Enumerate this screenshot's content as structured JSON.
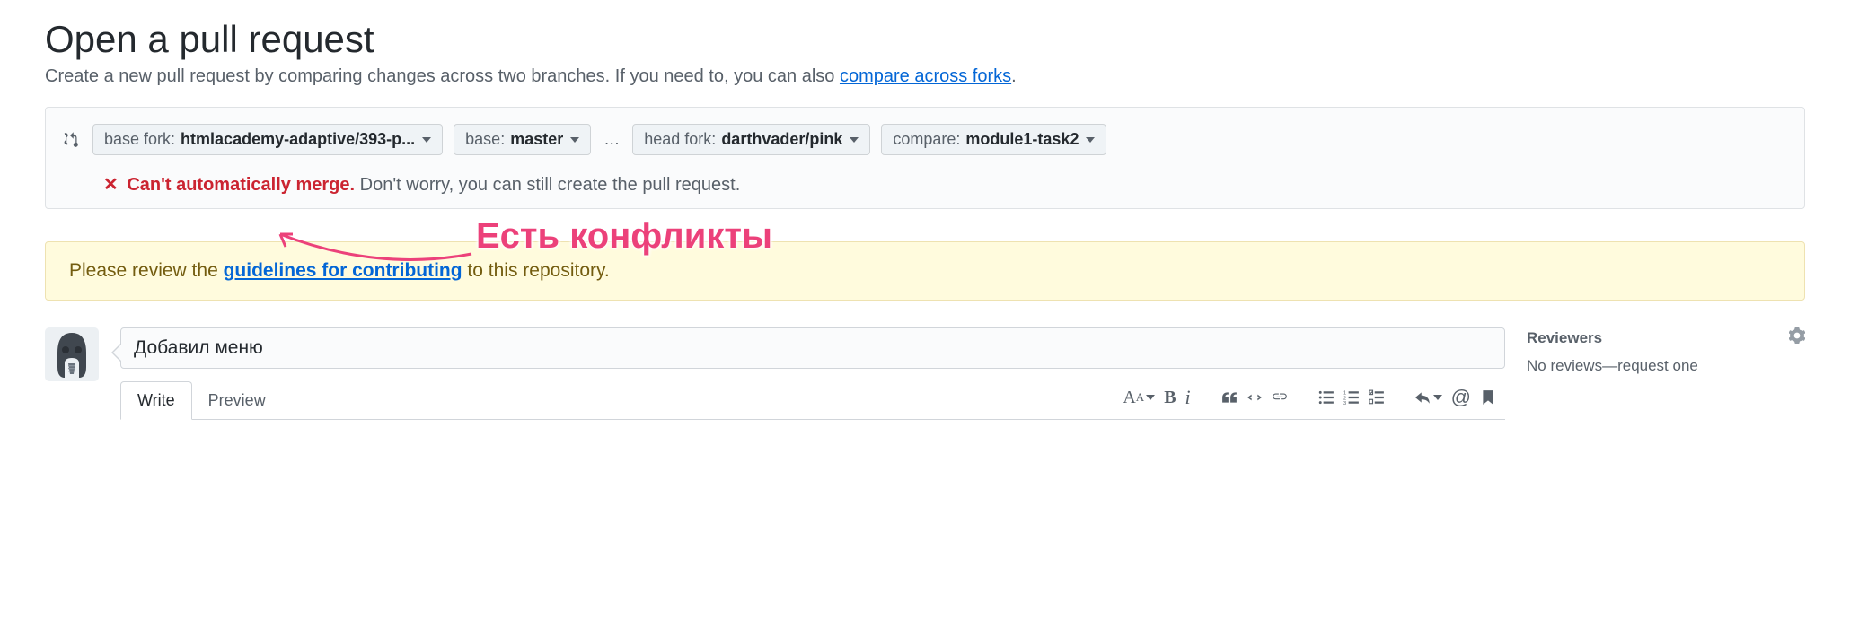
{
  "header": {
    "title": "Open a pull request",
    "subtitle_pre": "Create a new pull request by comparing changes across two branches. If you need to, you can also ",
    "subtitle_link": "compare across forks",
    "subtitle_post": "."
  },
  "compare": {
    "base_fork": {
      "label": "base fork:",
      "value": "htmlacademy-adaptive/393-p..."
    },
    "base": {
      "label": "base:",
      "value": "master"
    },
    "head_fork": {
      "label": "head fork:",
      "value": "darthvader/pink"
    },
    "compare_branch": {
      "label": "compare:",
      "value": "module1-task2"
    },
    "ellipsis": "…"
  },
  "merge_status": {
    "error": "Can't automatically merge.",
    "rest": " Don't worry, you can still create the pull request."
  },
  "annotation": "Есть конфликты",
  "contrib": {
    "pre": "Please review the ",
    "link": "guidelines for contributing",
    "post": " to this repository."
  },
  "form": {
    "title_value": "Добавил меню",
    "tabs": {
      "write": "Write",
      "preview": "Preview"
    }
  },
  "sidebar": {
    "reviewers": {
      "title": "Reviewers",
      "body": "No reviews—request one"
    }
  },
  "toolbar_icons": {
    "text_size": "AA",
    "bold": "B",
    "italic": "i",
    "quote": "quote-icon",
    "code": "code-icon",
    "link": "link-icon",
    "ul": "unordered-list-icon",
    "ol": "ordered-list-icon",
    "task": "task-list-icon",
    "reply": "reply-icon",
    "mention": "@",
    "ref": "bookmark-icon"
  },
  "colors": {
    "accent": "#0366d6",
    "danger": "#cb2431",
    "annotation": "#ec417a"
  }
}
